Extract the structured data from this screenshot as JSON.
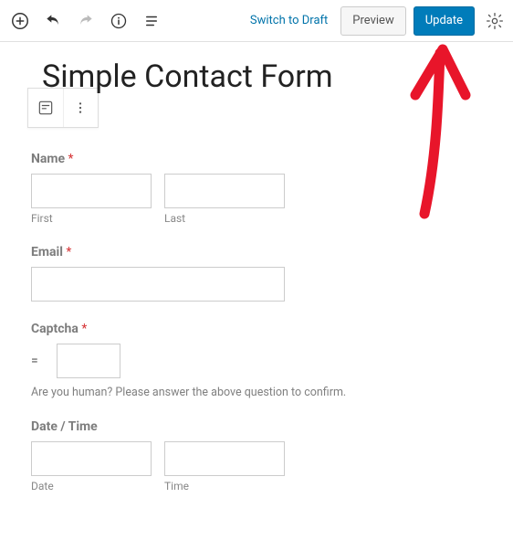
{
  "toolbar": {
    "switch_to_draft": "Switch to Draft",
    "preview": "Preview",
    "update": "Update"
  },
  "page": {
    "title": "Simple Contact Form"
  },
  "form": {
    "name": {
      "label": "Name",
      "required": "*",
      "first_sub": "First",
      "last_sub": "Last"
    },
    "email": {
      "label": "Email",
      "required": "*"
    },
    "captcha": {
      "label": "Captcha",
      "required": "*",
      "prefix": "=",
      "hint": "Are you human? Please answer the above question to confirm."
    },
    "datetime": {
      "label": "Date / Time",
      "date_sub": "Date",
      "time_sub": "Time"
    }
  }
}
